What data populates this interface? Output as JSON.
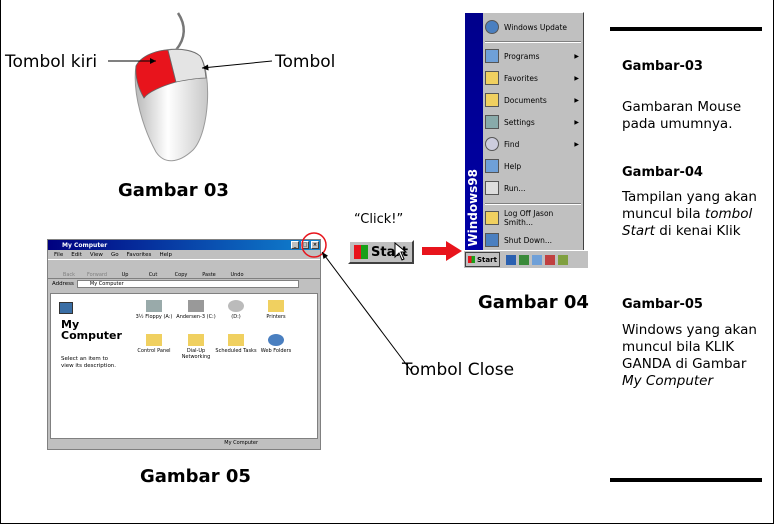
{
  "mouse": {
    "left_button_label": "Tombol kiri",
    "right_button_label": "Tombol",
    "caption": "Gambar 03"
  },
  "my_computer_window": {
    "title": "My Computer",
    "menu": [
      "File",
      "Edit",
      "View",
      "Go",
      "Favorites",
      "Help"
    ],
    "toolbar": [
      "Back",
      "Forward",
      "Up",
      "Cut",
      "Copy",
      "Paste",
      "Undo"
    ],
    "address_label": "Address",
    "address_value": "My Computer",
    "panel_title_1": "My",
    "panel_title_2": "Computer",
    "panel_hint": "Select an item to view its description.",
    "items": [
      "3½ Floppy (A:)",
      "Andersen-3 (C:)",
      "(D:)",
      "Printers",
      "Control Panel",
      "Dial-Up Networking",
      "Scheduled Tasks",
      "Web Folders"
    ],
    "status": "My Computer",
    "caption": "Gambar 05",
    "close_label": "Tombol Close"
  },
  "start": {
    "click_text": "“Click!”",
    "button_label": "Start"
  },
  "start_menu": {
    "band_text": "Windows98",
    "items": [
      "Windows Update",
      "Programs",
      "Favorites",
      "Documents",
      "Settings",
      "Find",
      "Help",
      "Run...",
      "Log Off Jason Smith...",
      "Shut Down..."
    ],
    "taskbar_start": "Start",
    "caption": "Gambar 04"
  },
  "sidebar": {
    "heading_1": "Gambar-03",
    "text_1": "Gambaran Mouse pada umumnya.",
    "heading_2": "Gambar-04",
    "text_2a": "Tampilan  yang akan muncul bila ",
    "text_2b": "tombol Start",
    "text_2c": "  di kenai Klik",
    "heading_3": "Gambar-05",
    "text_3a": "Windows yang akan muncul bila KLIK GANDA di Gambar ",
    "text_3b": "My Computer"
  },
  "colors": {
    "mouse_button_red": "#e8141c",
    "arrow_red": "#e8141c",
    "title_bar_blue": "#000080"
  }
}
